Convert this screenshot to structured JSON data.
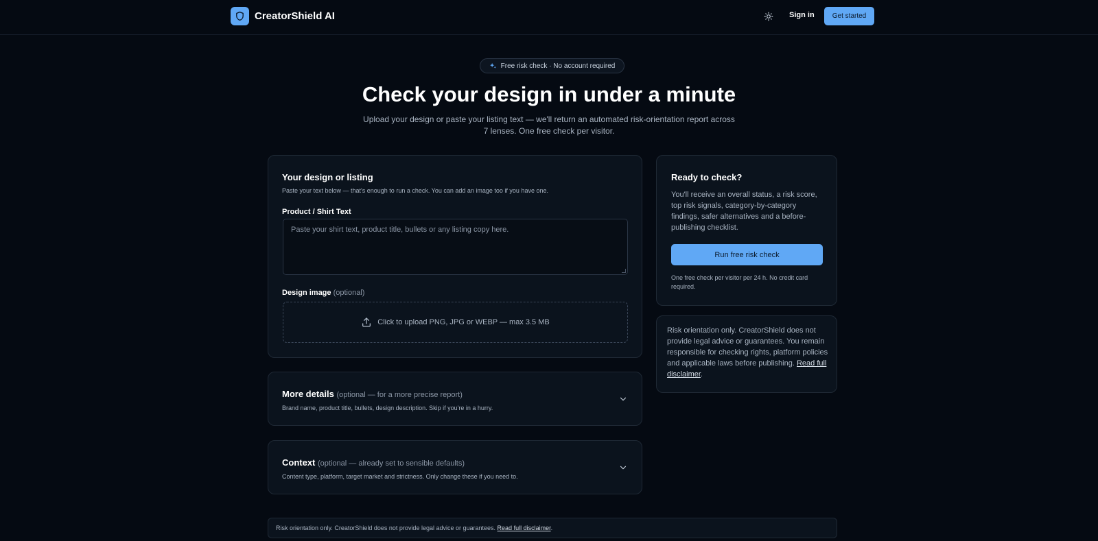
{
  "nav": {
    "brand": "CreatorShield AI",
    "sign_in": "Sign in",
    "get_started": "Get started"
  },
  "hero": {
    "badge": "Free risk check · No account required",
    "title": "Check your design in under a minute",
    "subtitle": "Upload your design or paste your listing text — we'll return an automated risk-orientation report across 7 lenses. One free check per visitor."
  },
  "design_card": {
    "title": "Your design or listing",
    "subtitle": "Paste your text below — that's enough to run a check. You can add an image too if you have one.",
    "text_label": "Product / Shirt Text",
    "text_placeholder": "Paste your shirt text, product title, bullets or any listing copy here.",
    "image_label": "Design image",
    "image_optional": "(optional)",
    "upload_text": "Click to upload PNG, JPG or WEBP — max 3.5 MB"
  },
  "more_details": {
    "title": "More details",
    "optional": "(optional — for a more precise report)",
    "subtitle": "Brand name, product title, bullets, design description. Skip if you're in a hurry."
  },
  "context": {
    "title": "Context",
    "optional": "(optional — already set to sensible defaults)",
    "subtitle": "Content type, platform, target market and strictness. Only change these if you need to."
  },
  "ready": {
    "title": "Ready to check?",
    "body": "You'll receive an overall status, a risk score, top risk signals, category-by-category findings, safer alternatives and a before-publishing checklist.",
    "button": "Run free risk check",
    "note": "One free check per visitor per 24 h. No credit card required."
  },
  "disclaimer": {
    "body": "Risk orientation only. CreatorShield does not provide legal advice or guarantees. You remain responsible for checking rights, platform policies and applicable laws before publishing.",
    "link": "Read full disclaimer"
  },
  "footer": {
    "text": "Risk orientation only. CreatorShield does not provide legal advice or guarantees.",
    "link": "Read full disclaimer"
  },
  "colors": {
    "accent": "#60a8f5",
    "background": "#050a12",
    "card": "#0b131d"
  }
}
